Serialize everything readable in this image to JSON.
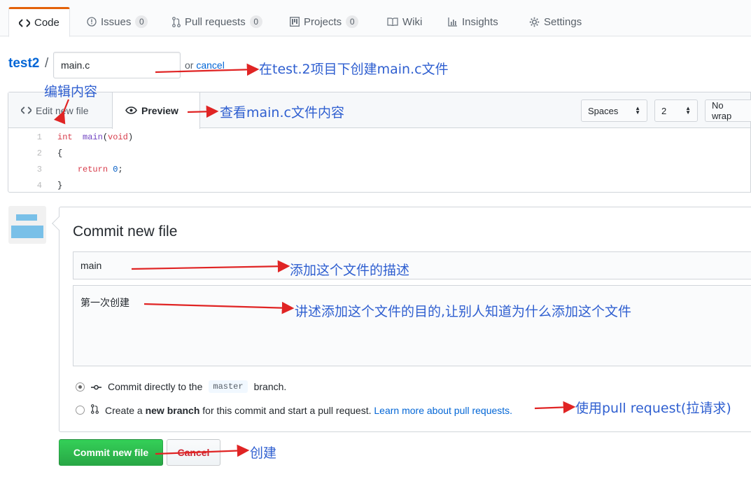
{
  "nav": {
    "tabs": [
      {
        "label": "Code",
        "icon": "code-icon",
        "active": true
      },
      {
        "label": "Issues",
        "icon": "issue-icon",
        "count": "0"
      },
      {
        "label": "Pull requests",
        "icon": "pull-request-icon",
        "count": "0"
      },
      {
        "label": "Projects",
        "icon": "project-icon",
        "count": "0"
      },
      {
        "label": "Wiki",
        "icon": "book-icon"
      },
      {
        "label": "Insights",
        "icon": "graph-icon"
      },
      {
        "label": "Settings",
        "icon": "gear-icon"
      }
    ]
  },
  "breadcrumb": {
    "repo": "test2",
    "separator": "/",
    "filename_value": "main.c",
    "or_text": "or",
    "cancel_link": "cancel"
  },
  "editor": {
    "edit_tab": "Edit new file",
    "preview_tab": "Preview",
    "indent_mode": "Spaces",
    "indent_size": "2",
    "wrap_mode": "No wrap",
    "lines": [
      {
        "num": "1",
        "parts": [
          [
            "kw",
            "int"
          ],
          [
            "",
            "  "
          ],
          [
            "fn",
            "main"
          ],
          [
            "",
            "("
          ],
          [
            "kw",
            "void"
          ],
          [
            "",
            ")"
          ]
        ]
      },
      {
        "num": "2",
        "parts": [
          [
            "",
            "{"
          ]
        ]
      },
      {
        "num": "3",
        "parts": [
          [
            "",
            "    "
          ],
          [
            "kw",
            "return"
          ],
          [
            "",
            " "
          ],
          [
            "num",
            "0"
          ],
          [
            "",
            ";"
          ]
        ]
      },
      {
        "num": "4",
        "parts": [
          [
            "",
            "}"
          ]
        ]
      }
    ]
  },
  "commit": {
    "title": "Commit new file",
    "summary_value": "main",
    "description_value": "第一次创建",
    "option_direct_prefix": "Commit directly to the",
    "option_direct_branch": "master",
    "option_direct_suffix": "branch.",
    "option_new_prefix": "Create a",
    "option_new_bold": "new branch",
    "option_new_suffix": "for this commit and start a pull request.",
    "option_new_link": "Learn more about pull requests.",
    "commit_button": "Commit new file",
    "cancel_button": "Cancel"
  },
  "annotations": {
    "filename_note": "在test.2项目下创建main.c文件",
    "edit_note": "编辑内容",
    "preview_note": "查看main.c文件内容",
    "summary_note": "添加这个文件的描述",
    "description_note": "讲述添加这个文件的目的,让别人知道为什么添加这个文件",
    "pull_request_note": "使用pull request(拉请求)",
    "create_note": "创建"
  },
  "colors": {
    "link": "#0366d6",
    "annotation": "#2f5fd0",
    "arrow": "#e02424",
    "commit_button": "#28a745"
  }
}
